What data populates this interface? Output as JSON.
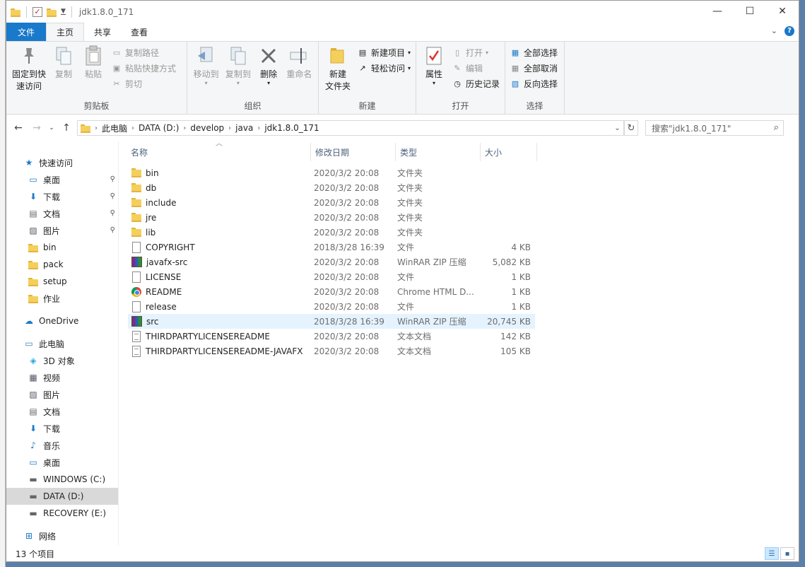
{
  "window": {
    "title": "jdk1.8.0_171"
  },
  "ribbon_tabs": [
    {
      "label": "文件"
    },
    {
      "label": "主页"
    },
    {
      "label": "共享"
    },
    {
      "label": "查看"
    }
  ],
  "ribbon": {
    "clipboard": {
      "label": "剪贴板",
      "pin": "固定到快\n速访问",
      "copy": "复制",
      "paste": "粘贴",
      "copy_path": "复制路径",
      "paste_shortcut": "粘贴快捷方式",
      "cut": "剪切"
    },
    "organize": {
      "label": "组织",
      "move_to": "移动到",
      "copy_to": "复制到",
      "delete": "删除",
      "rename": "重命名"
    },
    "new": {
      "label": "新建",
      "new_folder": "新建\n文件夹",
      "new_item": "新建项目",
      "easy_access": "轻松访问"
    },
    "open": {
      "label": "打开",
      "properties": "属性",
      "open": "打开",
      "edit": "编辑",
      "history": "历史记录"
    },
    "select": {
      "label": "选择",
      "select_all": "全部选择",
      "select_none": "全部取消",
      "invert": "反向选择"
    }
  },
  "address": {
    "crumbs": [
      "此电脑",
      "DATA (D:)",
      "develop",
      "java",
      "jdk1.8.0_171"
    ],
    "search_placeholder": "搜索\"jdk1.8.0_171\""
  },
  "nav": {
    "items": [
      {
        "label": "快速访问",
        "icon": "star-icon",
        "top": true
      },
      {
        "label": "桌面",
        "icon": "desktop-icon",
        "pinned": true
      },
      {
        "label": "下载",
        "icon": "download-icon",
        "pinned": true
      },
      {
        "label": "文档",
        "icon": "document-icon",
        "pinned": true
      },
      {
        "label": "图片",
        "icon": "picture-icon",
        "pinned": true
      },
      {
        "label": "bin",
        "icon": "folder-icon"
      },
      {
        "label": "pack",
        "icon": "folder-icon"
      },
      {
        "label": "setup",
        "icon": "folder-icon"
      },
      {
        "label": "作业",
        "icon": "folder-icon"
      },
      {
        "label": "OneDrive",
        "icon": "cloud-icon",
        "top": true
      },
      {
        "label": "此电脑",
        "icon": "computer-icon",
        "top": true
      },
      {
        "label": "3D 对象",
        "icon": "cube-icon"
      },
      {
        "label": "视频",
        "icon": "video-icon"
      },
      {
        "label": "图片",
        "icon": "picture-icon"
      },
      {
        "label": "文档",
        "icon": "document-icon"
      },
      {
        "label": "下载",
        "icon": "download-icon"
      },
      {
        "label": "音乐",
        "icon": "music-icon"
      },
      {
        "label": "桌面",
        "icon": "desktop-icon"
      },
      {
        "label": "WINDOWS (C:)",
        "icon": "drive-icon"
      },
      {
        "label": "DATA (D:)",
        "icon": "drive-icon",
        "selected": true
      },
      {
        "label": "RECOVERY (E:)",
        "icon": "drive-icon"
      },
      {
        "label": "网络",
        "icon": "network-icon",
        "top": true
      }
    ]
  },
  "columns": {
    "name": "名称",
    "date": "修改日期",
    "type": "类型",
    "size": "大小"
  },
  "files": [
    {
      "name": "bin",
      "date": "2020/3/2 20:08",
      "type": "文件夹",
      "size": "",
      "icon": "folder"
    },
    {
      "name": "db",
      "date": "2020/3/2 20:08",
      "type": "文件夹",
      "size": "",
      "icon": "folder"
    },
    {
      "name": "include",
      "date": "2020/3/2 20:08",
      "type": "文件夹",
      "size": "",
      "icon": "folder"
    },
    {
      "name": "jre",
      "date": "2020/3/2 20:08",
      "type": "文件夹",
      "size": "",
      "icon": "folder"
    },
    {
      "name": "lib",
      "date": "2020/3/2 20:08",
      "type": "文件夹",
      "size": "",
      "icon": "folder"
    },
    {
      "name": "COPYRIGHT",
      "date": "2018/3/28 16:39",
      "type": "文件",
      "size": "4 KB",
      "icon": "doc"
    },
    {
      "name": "javafx-src",
      "date": "2020/3/2 20:08",
      "type": "WinRAR ZIP 压缩",
      "size": "5,082 KB",
      "icon": "rar"
    },
    {
      "name": "LICENSE",
      "date": "2020/3/2 20:08",
      "type": "文件",
      "size": "1 KB",
      "icon": "doc"
    },
    {
      "name": "README",
      "date": "2020/3/2 20:08",
      "type": "Chrome HTML D...",
      "size": "1 KB",
      "icon": "chrome"
    },
    {
      "name": "release",
      "date": "2020/3/2 20:08",
      "type": "文件",
      "size": "1 KB",
      "icon": "doc"
    },
    {
      "name": "src",
      "date": "2018/3/28 16:39",
      "type": "WinRAR ZIP 压缩",
      "size": "20,745 KB",
      "icon": "rar",
      "selected": true
    },
    {
      "name": "THIRDPARTYLICENSEREADME",
      "date": "2020/3/2 20:08",
      "type": "文本文档",
      "size": "142 KB",
      "icon": "txt"
    },
    {
      "name": "THIRDPARTYLICENSEREADME-JAVAFX",
      "date": "2020/3/2 20:08",
      "type": "文本文档",
      "size": "105 KB",
      "icon": "txt"
    }
  ],
  "status": {
    "count": "13 个项目"
  }
}
